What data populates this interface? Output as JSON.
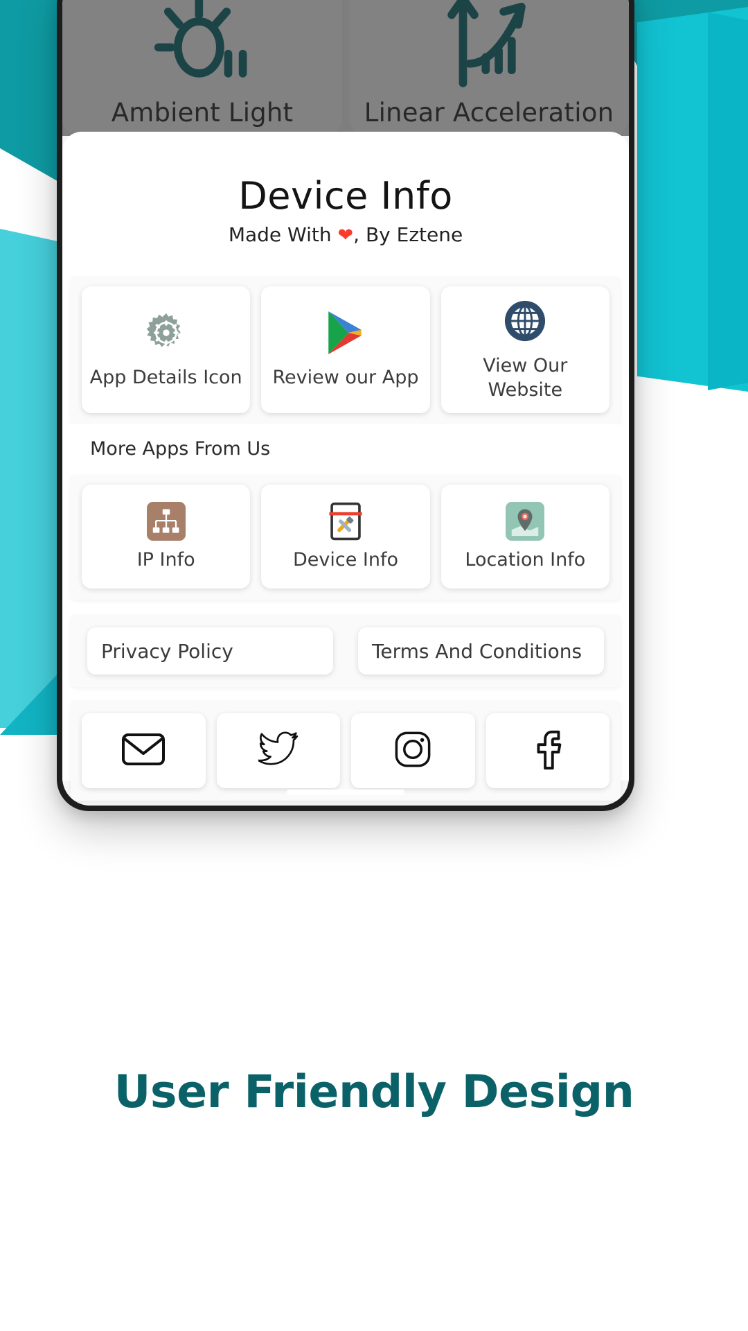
{
  "background": {
    "accent_dark": "#0f9ba3",
    "accent_light": "#45d0dc",
    "accent_mid": "#12b4c4"
  },
  "sensor_tiles": [
    {
      "label": "Ambient Light",
      "icon": "ambient-light-icon"
    },
    {
      "label": "Linear Acceleration",
      "icon": "linear-acceleration-icon"
    }
  ],
  "sheet": {
    "title": "Device Info",
    "subtitle_before": "Made With ",
    "subtitle_heart": "❤",
    "subtitle_after": ", By Eztene",
    "action_cards": [
      {
        "label": "App Details Icon",
        "icon": "gear-icon"
      },
      {
        "label": "Review our App",
        "icon": "play-store-icon"
      },
      {
        "label": "View Our Website",
        "icon": "globe-icon"
      }
    ],
    "more_apps_title": "More Apps From Us",
    "app_cards": [
      {
        "label": "IP Info",
        "icon": "ip-info-icon",
        "tile_color": "#a8806a"
      },
      {
        "label": "Device Info",
        "icon": "device-info-icon",
        "tile_color": "#ffffff"
      },
      {
        "label": "Location Info",
        "icon": "location-info-icon",
        "tile_color": "#93c5b4"
      }
    ],
    "legal_links": [
      {
        "label": "Privacy Policy"
      },
      {
        "label": "Terms And Conditions"
      }
    ],
    "social_links": [
      {
        "name": "email",
        "icon": "email-icon"
      },
      {
        "name": "twitter",
        "icon": "twitter-icon"
      },
      {
        "name": "instagram",
        "icon": "instagram-icon"
      },
      {
        "name": "facebook",
        "icon": "facebook-icon"
      }
    ]
  },
  "tagline": {
    "text": "User Friendly Design",
    "color": "#0a6168"
  }
}
